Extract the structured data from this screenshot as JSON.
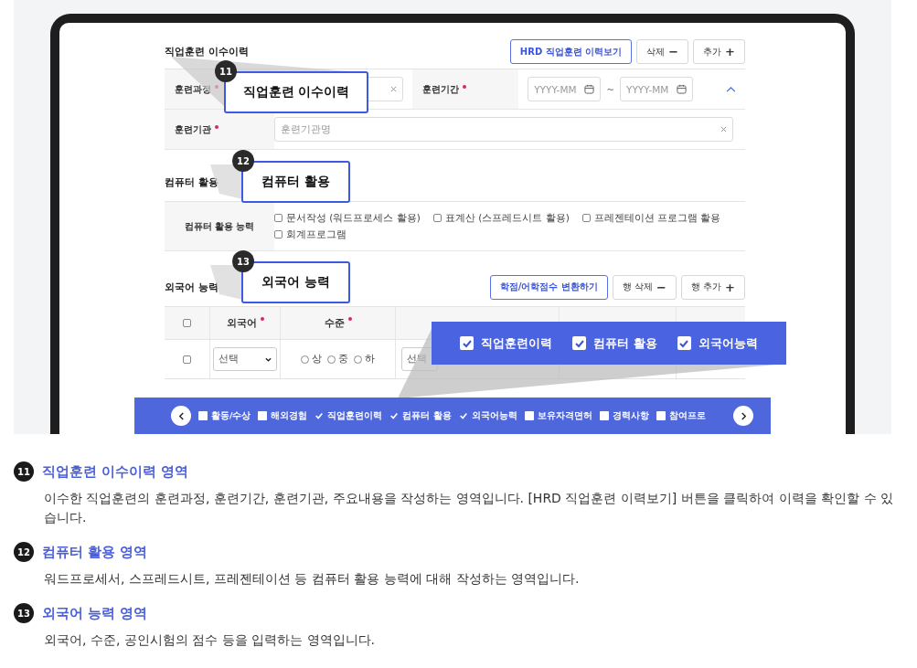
{
  "training": {
    "title": "직업훈련 이수이력",
    "buttons": [
      {
        "label": "HRD 직업훈련 이력보기",
        "kind": "primary"
      },
      {
        "label": "삭제",
        "sign": "−",
        "kind": "plain"
      },
      {
        "label": "추가",
        "sign": "+",
        "kind": "plain"
      }
    ],
    "course": {
      "label": "훈련과정",
      "required": true
    },
    "period": {
      "label": "훈련기간",
      "required": true,
      "start_placeholder": "YYYY-MM",
      "separator": "~",
      "end_placeholder": "YYYY-MM"
    },
    "institution": {
      "label": "훈련기관",
      "required": true,
      "placeholder": "훈련기관명"
    }
  },
  "computer": {
    "title": "컴퓨터 활용",
    "row_label": "컴퓨터 활용 능력",
    "options": [
      {
        "label": "문서작성 (워드프로세스 활용)",
        "checked": false
      },
      {
        "label": "표계산 (스프레드시트 활용)",
        "checked": false
      },
      {
        "label": "프레젠테이션 프로그램 활용",
        "checked": false
      },
      {
        "label": "회계프로그램",
        "checked": false
      }
    ]
  },
  "language": {
    "title": "외국어 능력",
    "buttons": [
      {
        "label": "학점/어학점수 변환하기",
        "kind": "primary"
      },
      {
        "label": "행 삭제",
        "sign": "−",
        "kind": "plain"
      },
      {
        "label": "행 추가",
        "sign": "+",
        "kind": "plain"
      }
    ],
    "header_checked": false,
    "columns": [
      {
        "label": "외국어",
        "required": true
      },
      {
        "label": "수준",
        "required": true
      }
    ],
    "row": {
      "checked": false,
      "language": "선택",
      "levels": [
        {
          "label": "상",
          "selected": false
        },
        {
          "label": "중",
          "selected": false
        },
        {
          "label": "하",
          "selected": false
        }
      ],
      "exam": "선택"
    }
  },
  "callouts": [
    {
      "number": "11",
      "text": "직업훈련 이수이력"
    },
    {
      "number": "12",
      "text": "컴퓨터 활용"
    },
    {
      "number": "13",
      "text": "외국어 능력"
    }
  ],
  "banner": [
    {
      "label": "직업훈련이력",
      "checked": true
    },
    {
      "label": "컴퓨터 활용",
      "checked": true
    },
    {
      "label": "외국어능력",
      "checked": true
    }
  ],
  "section_bar": [
    {
      "label": "활동/수상",
      "checked": false
    },
    {
      "label": "해외경험",
      "checked": false
    },
    {
      "label": "직업훈련이력",
      "checked": true
    },
    {
      "label": "컴퓨터 활용",
      "checked": true
    },
    {
      "label": "외국어능력",
      "checked": true
    },
    {
      "label": "보유자격면허",
      "checked": false
    },
    {
      "label": "경력사항",
      "checked": false
    },
    {
      "label": "참여프로",
      "checked": false
    }
  ],
  "descriptions": [
    {
      "number": "11",
      "title": "직업훈련 이수이력 영역",
      "body": "이수한 직업훈련의 훈련과정, 훈련기간, 훈련기관, 주요내용을 작성하는 영역입니다. [HRD 직업훈련 이력보기] 버튼을 클릭하여 이력을 확인할 수 있습니다."
    },
    {
      "number": "12",
      "title": "컴퓨터 활용 영역",
      "body": "워드프로세서, 스프레드시트, 프레젠테이션 등 컴퓨터 활용 능력에 대해 작성하는 영역입니다."
    },
    {
      "number": "13",
      "title": "외국어 능력 영역",
      "body": "외국어, 수준, 공인시험의 점수 등을 입력하는 영역입니다."
    }
  ]
}
